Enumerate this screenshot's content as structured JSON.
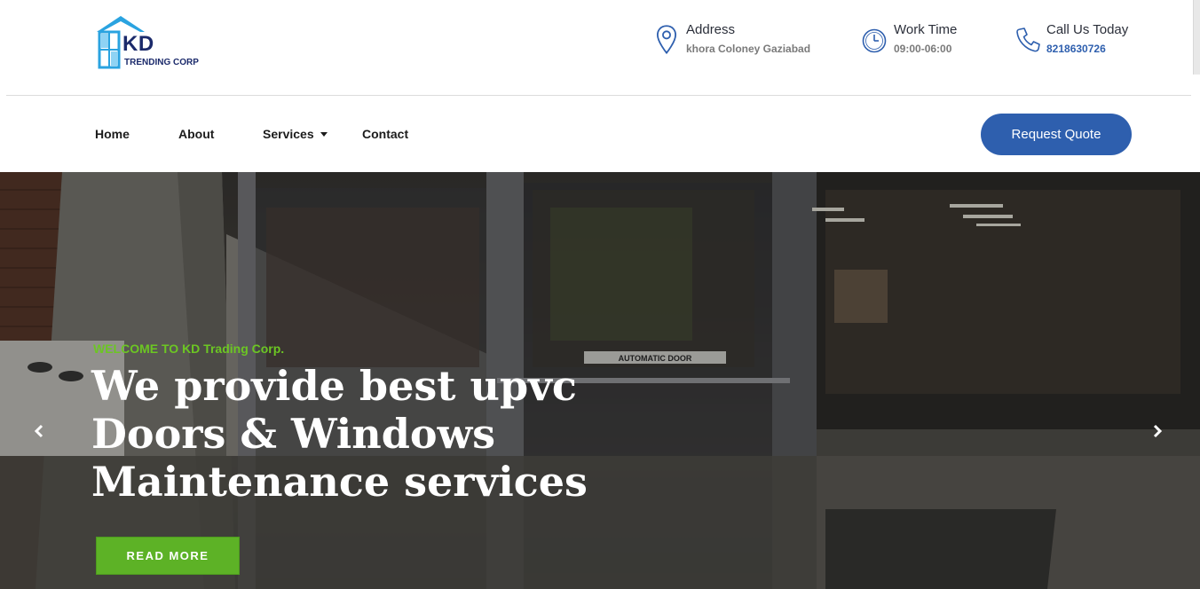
{
  "brand": {
    "logo_main": "KD",
    "logo_sub": "TRENDING CORP"
  },
  "contact_info": [
    {
      "title": "Address",
      "value": "khora Coloney Gaziabad",
      "icon": "location-pin-icon"
    },
    {
      "title": "Work Time",
      "value": "09:00-06:00",
      "icon": "clock-icon"
    },
    {
      "title": "Call Us Today",
      "value": "8218630726",
      "icon": "phone-icon"
    }
  ],
  "nav": {
    "items": [
      "Home",
      "About",
      "Services",
      "Contact"
    ],
    "quote_label": "Request Quote"
  },
  "hero": {
    "welcome": "WELCOME TO KD Trading Corp.",
    "headline_lines": [
      "We provide best upvc",
      "Doors & Windows",
      "Maintenance services"
    ],
    "button_label": "READ MORE",
    "door_sign": "AUTOMATIC DOOR"
  },
  "colors": {
    "brand_blue": "#2e5fae",
    "logo_navy": "#1b2a6b",
    "accent_green": "#5db226",
    "welcome_green": "#6cc623"
  }
}
